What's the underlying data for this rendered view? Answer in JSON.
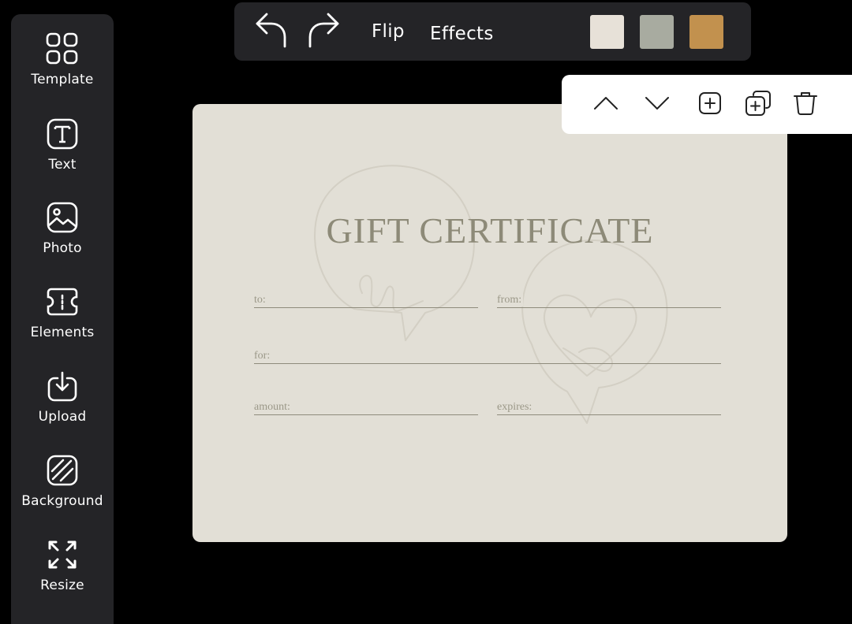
{
  "sidebar": {
    "items": [
      {
        "label": "Template",
        "icon": "template-grid-icon"
      },
      {
        "label": "Text",
        "icon": "text-icon"
      },
      {
        "label": "Photo",
        "icon": "photo-icon"
      },
      {
        "label": "Elements",
        "icon": "elements-ticket-icon"
      },
      {
        "label": "Upload",
        "icon": "upload-icon"
      },
      {
        "label": "Background",
        "icon": "background-stripes-icon"
      },
      {
        "label": "Resize",
        "icon": "resize-arrows-icon"
      }
    ]
  },
  "toolbar": {
    "undo_icon": "undo-arrow-icon",
    "redo_icon": "redo-arrow-icon",
    "flip_label": "Flip",
    "effects_label": "Effects",
    "swatches": [
      "#e7e1d8",
      "#a8aba0",
      "#c2914e"
    ]
  },
  "context_bar": {
    "icons": [
      "chevron-up-icon",
      "chevron-down-icon",
      "add-square-icon",
      "duplicate-icon",
      "trash-icon"
    ]
  },
  "certificate": {
    "title": "GIFT CERTIFICATE",
    "fields": {
      "to": "to:",
      "from": "from:",
      "for": "for:",
      "amount": "amount:",
      "expires": "expires:"
    },
    "colors": {
      "background": "#e2dfd6",
      "title": "#8d8a78",
      "rule": "#8e8b7c"
    }
  }
}
